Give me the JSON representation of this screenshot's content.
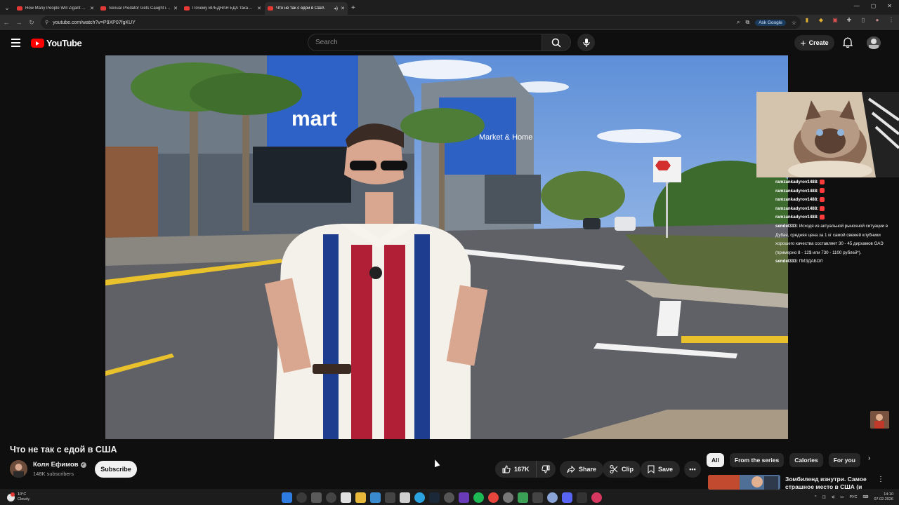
{
  "browser": {
    "tabs": [
      {
        "title": "How Many People Will Zigant Take To...",
        "active": false
      },
      {
        "title": "Sexual Predator Gets Caught in...",
        "active": false
      },
      {
        "title": "Почему ВРЕДНАЯ ЕДА такая В...",
        "active": false
      },
      {
        "title": "Что не так с едой в США",
        "active": true
      }
    ],
    "url": "youtube.com/watch?v=P9XP07fgKUY",
    "ask_google": "Ask Google"
  },
  "youtube": {
    "logo_text": "YouTube",
    "search_placeholder": "Search",
    "create_label": "Create"
  },
  "stream_chat": [
    {
      "user": "ramzankadyrov1488:",
      "text": ""
    },
    {
      "user": "ramzankadyrov1488:",
      "text": ""
    },
    {
      "user": "ramzankadyrov1488:",
      "text": ""
    },
    {
      "user": "ramzankadyrov1488:",
      "text": ""
    },
    {
      "user": "ramzankadyrov1488:",
      "text": ""
    },
    {
      "user": "sendel333:",
      "text": "Исходя из актуальной рыночной ситуации в Дубае, средняя цена за 1 кг самой свежей клубники хорошего качества составляет 30 - 45 дирхамов ОАЭ (примерно 8 - 12$ или 730 - 1100 рублей*)."
    },
    {
      "user": "sendel333:",
      "text": "ПИЗДАБОЛ"
    }
  ],
  "video": {
    "title": "Что не так с едой в США",
    "channel": "Коля Ефимов",
    "subscribers": "148K subscribers",
    "subscribe_label": "Subscribe",
    "likes": "167K",
    "share_label": "Share",
    "clip_label": "Clip",
    "save_label": "Save"
  },
  "chips": [
    "All",
    "From the series",
    "Calories",
    "For you"
  ],
  "recommendation": {
    "title": "Зомбиленд изнутри. Самое страшное место в США (и в..."
  },
  "taskbar": {
    "weather_temp": "10°C",
    "weather_desc": "Cloudy",
    "lang": "РУС",
    "time": "14:10",
    "date": "07.02.2026"
  },
  "colors": {
    "brand_red": "#ff0000",
    "background": "#0f0f0f",
    "pill": "#272727"
  }
}
